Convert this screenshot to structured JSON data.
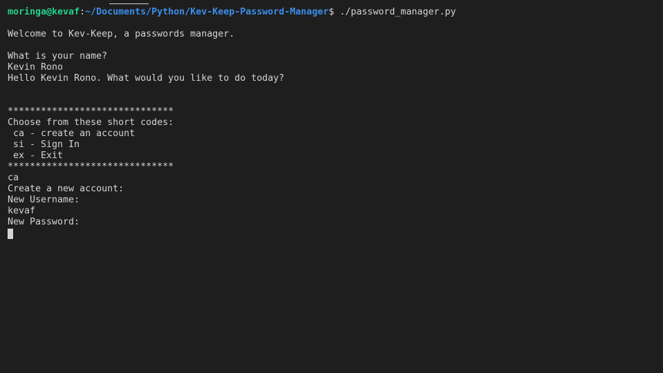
{
  "prompt": {
    "user_host": "moringa@kevaf",
    "separator": ":",
    "path": "~/Documents/Python/Kev-Keep-Password-Manager",
    "symbol": "$ ",
    "command": "./password_manager.py"
  },
  "output": [
    "",
    "Welcome to Kev-Keep, a passwords manager.",
    "",
    "What is your name?",
    "Kevin Rono",
    "Hello Kevin Rono. What would you like to do today?",
    "",
    "",
    "******************************",
    "Choose from these short codes:",
    " ca - create an account",
    " si - Sign In",
    " ex - Exit",
    "******************************",
    "ca",
    "Create a new account:",
    "New Username:",
    "kevaf",
    "New Password:"
  ],
  "colors": {
    "background": "#1e1e1e",
    "foreground": "#d4d4d4",
    "user_host": "#23d18b",
    "path": "#3b8eea"
  }
}
